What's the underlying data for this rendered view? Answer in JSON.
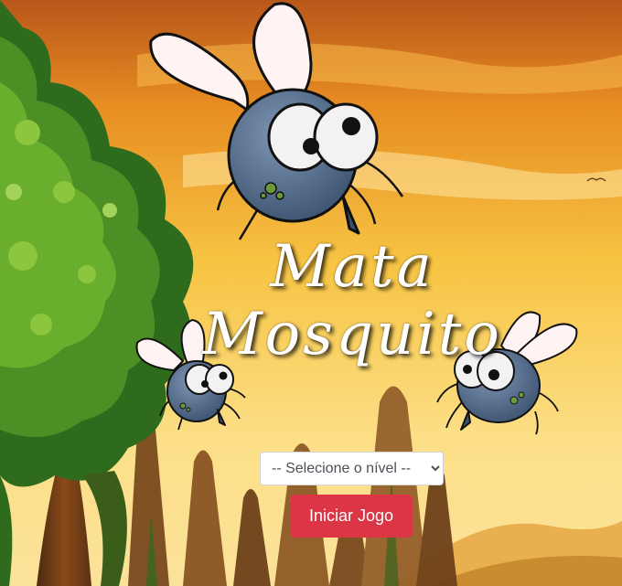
{
  "game": {
    "title_line1": "Mata",
    "title_line2": "Mosquito",
    "level_select": {
      "selected": "-- Selecione o nível --",
      "options": [
        "-- Selecione o nível --"
      ]
    },
    "start_button_label": "Iniciar Jogo"
  },
  "colors": {
    "sky_top": "#c45a12",
    "sky_mid": "#f2a526",
    "sky_bottom": "#fde7a0",
    "button": "#dc3545"
  },
  "icons": [
    "mosquito-icon",
    "tree-illustration",
    "bird-icon"
  ]
}
